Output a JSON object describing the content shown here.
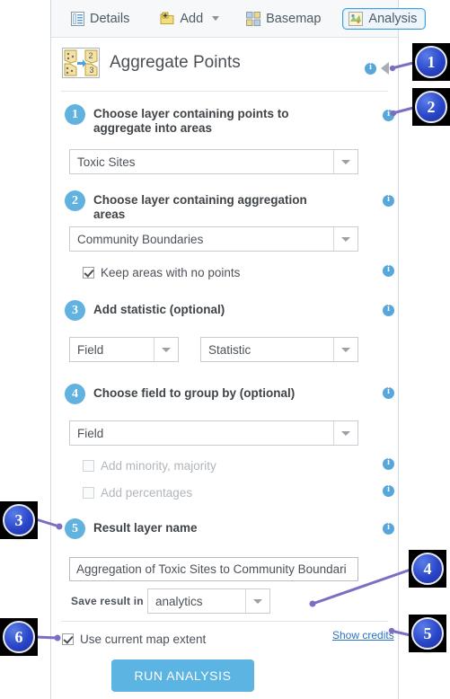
{
  "toolbar": {
    "details_label": "Details",
    "add_label": "Add",
    "basemap_label": "Basemap",
    "analysis_label": "Analysis",
    "icons": {
      "details": "details-icon",
      "add": "add-icon",
      "basemap": "basemap-icon",
      "analysis": "analysis-icon",
      "add_caret": "chevron-down-icon"
    }
  },
  "header": {
    "title": "Aggregate Points",
    "tool_icon": "aggregate-points-icon",
    "info_icon": "info-icon",
    "collapse_icon": "collapse-left-icon"
  },
  "steps": [
    {
      "number": "1",
      "title": "Choose layer containing points to aggregate into areas",
      "layer_value": "Toxic Sites"
    },
    {
      "number": "2",
      "title": "Choose layer containing aggregation areas",
      "layer_value": "Community Boundaries",
      "checkbox_label": "Keep areas with no points",
      "checkbox_checked": true
    },
    {
      "number": "3",
      "title": "Add statistic (optional)",
      "field_value": "Field",
      "statistic_value": "Statistic"
    },
    {
      "number": "4",
      "title": "Choose field to group by (optional)",
      "field_value": "Field",
      "minority_label": "Add minority, majority",
      "percentages_label": "Add percentages"
    },
    {
      "number": "5",
      "title": "Result layer name",
      "result_name": "Aggregation of Toxic Sites to Community Boundari",
      "save_label": "Save result in",
      "save_value": "analytics"
    }
  ],
  "footer": {
    "extent_label": "Use current map extent",
    "extent_checked": true,
    "credits_label": "Show credits",
    "run_label": "RUN ANALYSIS"
  },
  "callouts": [
    {
      "number": "1"
    },
    {
      "number": "2"
    },
    {
      "number": "3"
    },
    {
      "number": "4"
    },
    {
      "number": "5"
    },
    {
      "number": "6"
    }
  ],
  "colors": {
    "accent": "#5bb4e2",
    "badge": "#62b2e0",
    "info": "#58a7da",
    "link": "#2a73c2",
    "callout": "#2a46c8",
    "connector": "#7b6fc4"
  }
}
